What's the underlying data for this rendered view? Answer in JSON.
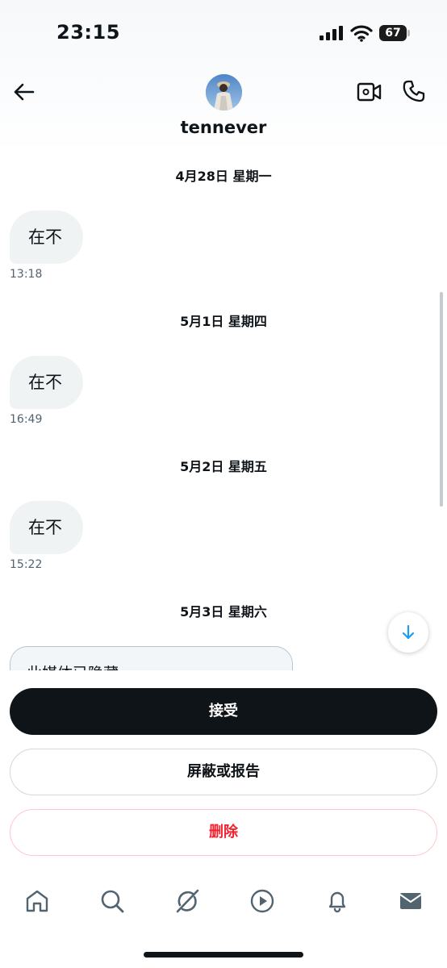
{
  "status_bar": {
    "time": "23:15",
    "battery": "67"
  },
  "header": {
    "username": "tennever"
  },
  "conversation": [
    {
      "date": "4月28日 星期一",
      "message": "在不",
      "time": "13:18"
    },
    {
      "date": "5月1日 星期四",
      "message": "在不",
      "time": "16:49"
    },
    {
      "date": "5月2日 星期五",
      "message": "在不",
      "time": "15:22"
    },
    {
      "date": "5月3日 星期六",
      "message": "此媒体已隐藏"
    }
  ],
  "actions": {
    "accept": "接受",
    "block_report": "屏蔽或报告",
    "delete": "删除"
  },
  "tabs": [
    {
      "icon": "home-icon"
    },
    {
      "icon": "search-icon"
    },
    {
      "icon": "grok-icon"
    },
    {
      "icon": "video-icon"
    },
    {
      "icon": "notifications-icon"
    },
    {
      "icon": "messages-icon"
    }
  ],
  "colors": {
    "accent_dark": "#0f1419",
    "danger": "#f4212e",
    "bubble": "#eff3f4",
    "secondary_text": "#536471"
  }
}
